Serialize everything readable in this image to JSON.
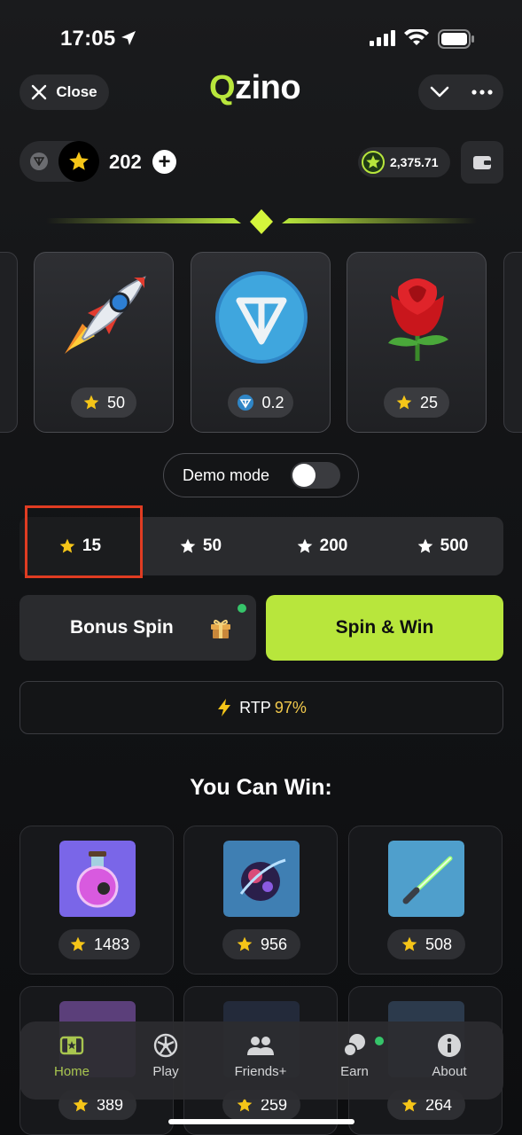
{
  "status": {
    "time": "17:05"
  },
  "header": {
    "close_label": "Close",
    "logo_q": "Q",
    "logo_rest": "zino"
  },
  "balance": {
    "stars": "202",
    "points": "2,375.71"
  },
  "prizes": [
    {
      "name": "rocket",
      "price": "50",
      "currency": "star"
    },
    {
      "name": "ton-coin",
      "price": "0.2",
      "currency": "ton"
    },
    {
      "name": "rose",
      "price": "25",
      "currency": "star"
    }
  ],
  "demo": {
    "label": "Demo mode",
    "enabled": false
  },
  "bets": [
    {
      "value": "15",
      "selected": true
    },
    {
      "value": "50",
      "selected": false
    },
    {
      "value": "200",
      "selected": false
    },
    {
      "value": "500",
      "selected": false
    }
  ],
  "actions": {
    "bonus_label": "Bonus Spin",
    "spin_label": "Spin & Win"
  },
  "rtp": {
    "label": "RTP",
    "value": "97%"
  },
  "win_section": {
    "title": "You Can Win:",
    "items": [
      {
        "name": "potion",
        "price": "1483"
      },
      {
        "name": "space-orb",
        "price": "956"
      },
      {
        "name": "lightsaber",
        "price": "508"
      },
      {
        "name": "item-4",
        "price": "389"
      },
      {
        "name": "item-5",
        "price": "259"
      },
      {
        "name": "item-6",
        "price": "264"
      }
    ]
  },
  "nav": [
    {
      "label": "Home",
      "icon": "home-icon",
      "active": true
    },
    {
      "label": "Play",
      "icon": "play-icon",
      "active": false
    },
    {
      "label": "Friends+",
      "icon": "friends-icon",
      "active": false
    },
    {
      "label": "Earn",
      "icon": "earn-icon",
      "active": false
    },
    {
      "label": "About",
      "icon": "about-icon",
      "active": false
    }
  ],
  "colors": {
    "accent": "#b8e63c",
    "rtp_value": "#f2c94c",
    "highlight": "#e03c22",
    "dot": "#36c46a"
  }
}
